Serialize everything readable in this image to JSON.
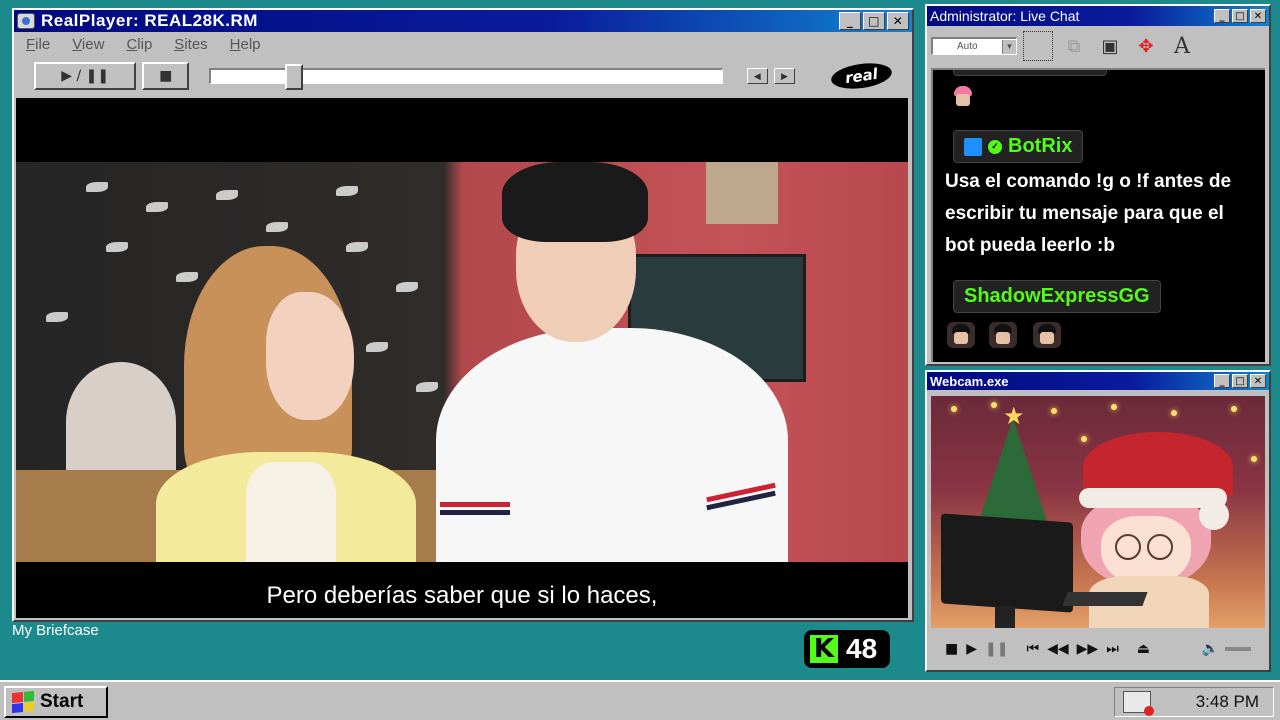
{
  "player": {
    "title": "RealPlayer: REAL28K.RM",
    "menu": [
      "File",
      "View",
      "Clip",
      "Sites",
      "Help"
    ],
    "play_pause_label": "▶ / ❚❚",
    "stop_label": "■",
    "logo_text": "real",
    "seek_progress": 0.15,
    "subtitle": "Pero deberías saber que si lo haces,"
  },
  "chat": {
    "title": "Administrator: Live Chat",
    "font_size_select": "Auto",
    "messages": [
      {
        "username": "BotRix",
        "text": "Usa el comando !g o !f antes de escribir tu mensaje para que el bot pueda leerlo :b"
      },
      {
        "username": "ShadowExpressGG",
        "text": ""
      }
    ],
    "colors": {
      "username": "#53fc18",
      "background": "#000000"
    }
  },
  "webcam": {
    "title": "Webcam.exe"
  },
  "desktop": {
    "briefcase_label": "My Briefcase",
    "kick_logo": "K",
    "viewer_count": "48",
    "background_color": "#1c8a8c"
  },
  "taskbar": {
    "start_label": "Start",
    "clock": "3:48 PM"
  }
}
